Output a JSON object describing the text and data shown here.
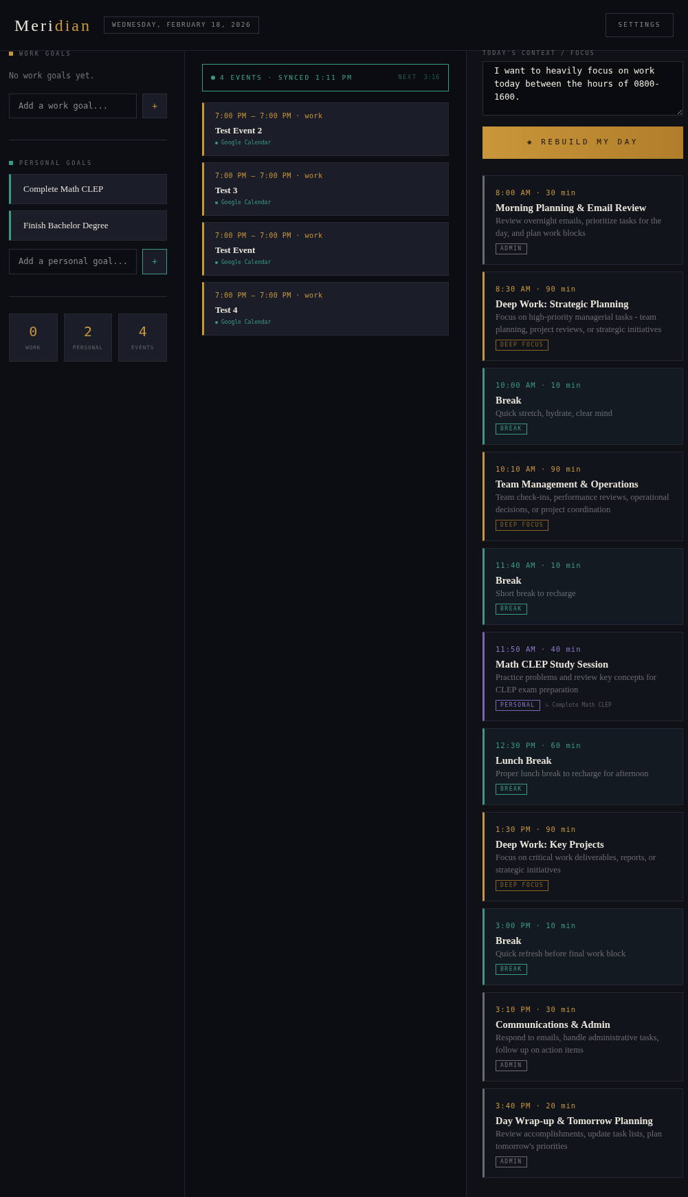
{
  "header": {
    "logo": [
      "Meri",
      "dian"
    ],
    "date": "WEDNESDAY, FEBRUARY 18, 2026",
    "settings": "SETTINGS"
  },
  "work_goals": {
    "heading": "WORK GOALS",
    "empty": "No work goals yet.",
    "placeholder": "Add a work goal...",
    "add": "+"
  },
  "personal_goals": {
    "heading": "PERSONAL GOALS",
    "items": [
      "Complete Math CLEP",
      "Finish Bachelor Degree"
    ],
    "placeholder": "Add a personal goal...",
    "add": "+"
  },
  "stats": [
    {
      "value": "0",
      "label": "WORK"
    },
    {
      "value": "2",
      "label": "PERSONAL"
    },
    {
      "value": "4",
      "label": "EVENTS"
    }
  ],
  "sync": {
    "status": "4 EVENTS · SYNCED 1:11 PM",
    "next_label": "NEXT",
    "next_value": "3:16"
  },
  "events": [
    {
      "time": "7:00 PM – 7:00 PM · work",
      "title": "Test Event 2",
      "source": "Google Calendar"
    },
    {
      "time": "7:00 PM – 7:00 PM · work",
      "title": "Test 3",
      "source": "Google Calendar"
    },
    {
      "time": "7:00 PM – 7:00 PM · work",
      "title": "Test Event",
      "source": "Google Calendar"
    },
    {
      "time": "7:00 PM – 7:00 PM · work",
      "title": "Test 4",
      "source": "Google Calendar"
    }
  ],
  "context": {
    "label": "TODAY'S CONTEXT / FOCUS",
    "value": "I want to heavily focus on work today between the hours of 0800-1600."
  },
  "rebuild_button": {
    "icon": "◈",
    "label": "REBUILD MY DAY"
  },
  "blocks": [
    {
      "kind": "admin",
      "time": "8:00 AM · 30 min",
      "title": "Morning Planning & Email Review",
      "description": "Review overnight emails, prioritize tasks for the day, and plan work blocks",
      "tag": "ADMIN"
    },
    {
      "kind": "focus",
      "time": "8:30 AM · 90 min",
      "title": "Deep Work: Strategic Planning",
      "description": "Focus on high-priority managerial tasks - team planning, project reviews, or strategic initiatives",
      "tag": "DEEP FOCUS"
    },
    {
      "kind": "break",
      "time": "10:00 AM · 10 min",
      "title": "Break",
      "description": "Quick stretch, hydrate, clear mind",
      "tag": "BREAK"
    },
    {
      "kind": "focus",
      "time": "10:10 AM · 90 min",
      "title": "Team Management & Operations",
      "description": "Team check-ins, performance reviews, operational decisions, or project coordination",
      "tag": "DEEP FOCUS"
    },
    {
      "kind": "break",
      "time": "11:40 AM · 10 min",
      "title": "Break",
      "description": "Short break to recharge",
      "tag": "BREAK"
    },
    {
      "kind": "personal",
      "time": "11:50 AM · 40 min",
      "title": "Math CLEP Study Session",
      "description": "Practice problems and review key concepts for CLEP exam preparation",
      "tag": "PERSONAL",
      "goal": "↳ Complete Math CLEP"
    },
    {
      "kind": "break",
      "time": "12:30 PM · 60 min",
      "title": "Lunch Break",
      "description": "Proper lunch break to recharge for afternoon",
      "tag": "BREAK"
    },
    {
      "kind": "focus",
      "time": "1:30 PM · 90 min",
      "title": "Deep Work: Key Projects",
      "description": "Focus on critical work deliverables, reports, or strategic initiatives",
      "tag": "DEEP FOCUS"
    },
    {
      "kind": "break",
      "time": "3:00 PM · 10 min",
      "title": "Break",
      "description": "Quick refresh before final work block",
      "tag": "BREAK"
    },
    {
      "kind": "admin",
      "time": "3:10 PM · 30 min",
      "title": "Communications & Admin",
      "description": "Respond to emails, handle administrative tasks, follow up on action items",
      "tag": "ADMIN"
    },
    {
      "kind": "admin",
      "time": "3:40 PM · 20 min",
      "title": "Day Wrap-up & Tomorrow Planning",
      "description": "Review accomplishments, update task lists, plan tomorrow's priorities",
      "tag": "ADMIN"
    }
  ]
}
